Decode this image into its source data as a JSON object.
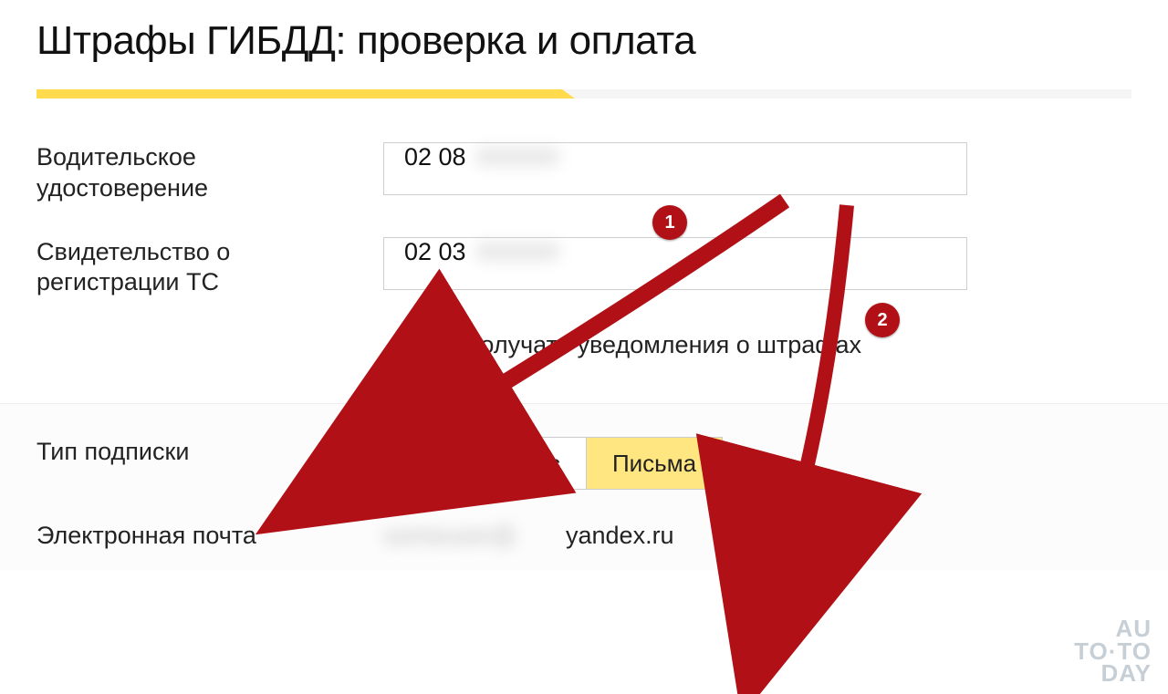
{
  "title": "Штрафы ГИБДД: проверка и оплата",
  "fields": {
    "license": {
      "label": "Водительское удостоверение",
      "value_visible": "02 08",
      "value_blurred": "000000"
    },
    "registration": {
      "label": "Свидетельство о регистрации ТС",
      "value_visible": "02 03",
      "value_blurred": "000000"
    }
  },
  "checkbox": {
    "label": "Получать уведомления о штрафах",
    "checked": true
  },
  "subscription": {
    "label": "Тип подписки",
    "options": [
      "Письма и смс",
      "Письма"
    ],
    "selected": 1
  },
  "email": {
    "label": "Электронная почта",
    "blurred_prefix": "someuser@",
    "visible_suffix": "yandex.ru"
  },
  "annotations": {
    "badge1": "1",
    "badge2": "2"
  },
  "watermark": {
    "l1": "AU",
    "l2": "TO·TO",
    "l3": "DAY"
  }
}
